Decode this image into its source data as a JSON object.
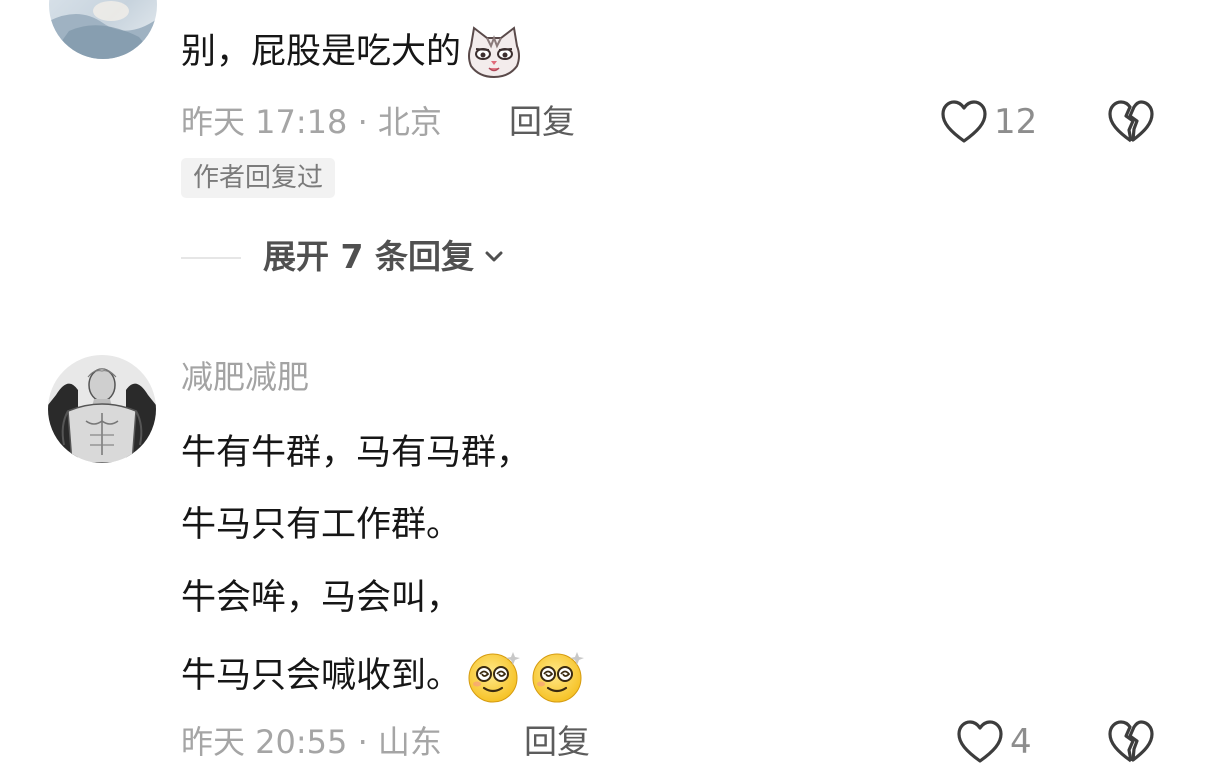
{
  "comments": [
    {
      "text_lines": [
        "别，屁股是吃大的"
      ],
      "emojis": [
        "cat-face-emoji"
      ],
      "time_location": "昨天 17:18 · 北京",
      "reply_label": "回复",
      "likes": "12",
      "author_tag": "作者回复过",
      "expand_label": "展开 7 条回复"
    },
    {
      "username": "减肥减肥",
      "text_lines": [
        "牛有牛群，马有马群，",
        "牛马只有工作群。",
        "牛会哞，马会叫，",
        "牛马只会喊收到。"
      ],
      "emojis": [
        "dizzy-smile-emoji",
        "dizzy-smile-emoji"
      ],
      "time_location": "昨天 20:55 · 山东",
      "reply_label": "回复",
      "likes": "4"
    }
  ],
  "icons": {
    "like": "heart-outline-icon",
    "dislike": "broken-heart-icon",
    "expand": "chevron-down-icon"
  },
  "colors": {
    "background": "#ffffff",
    "text": "#161616",
    "meta": "#a5a5a5",
    "reply": "#5c5c5c",
    "tag_bg": "#f2f2f2"
  }
}
